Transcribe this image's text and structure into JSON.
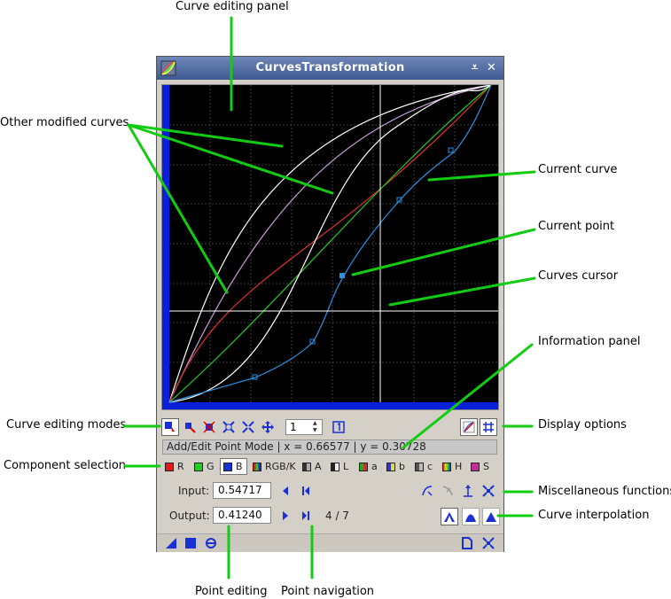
{
  "annotations": {
    "curve_editing_panel": "Curve editing panel",
    "other_modified_curves": "Other modified curves",
    "current_curve": "Current curve",
    "current_point": "Current point",
    "curves_cursor": "Curves cursor",
    "information_panel": "Information panel",
    "curve_editing_modes": "Curve editing modes",
    "display_options": "Display options",
    "component_selection": "Component selection",
    "miscellaneous_functions": "Miscellaneous functions",
    "curve_interpolation": "Curve interpolation",
    "point_editing": "Point editing",
    "point_navigation": "Point navigation"
  },
  "window": {
    "title": "CurvesTransformation",
    "shade_glyph": "⩡",
    "close_glyph": "✕"
  },
  "toolbar": {
    "zoom_value": "1",
    "icons": [
      "add-edit-point-icon",
      "select-point-icon",
      "delete-point-icon",
      "zoom-in-icon",
      "zoom-out-icon",
      "pan-icon",
      "zoom-one-icon",
      "show-all-curves-icon",
      "show-grid-icon"
    ]
  },
  "info_panel": {
    "text": "Add/Edit Point Mode | x = 0.66577 | y = 0.30728"
  },
  "components": [
    {
      "label": "R",
      "color": "#dd1c1c"
    },
    {
      "label": "G",
      "color": "#22cc22"
    },
    {
      "label": "B",
      "color": "#1a2fd6"
    },
    {
      "label": "RGB/K",
      "color": "#999999"
    },
    {
      "label": "A",
      "color": "#888888"
    },
    {
      "label": "L",
      "color": "#aaaaaa"
    },
    {
      "label": "a",
      "color": "#c04040"
    },
    {
      "label": "b",
      "color": "#4040c0"
    },
    {
      "label": "c",
      "color": "#888888"
    },
    {
      "label": "H",
      "color": "#d08020"
    },
    {
      "label": "S",
      "color": "#c03090"
    }
  ],
  "point_editor": {
    "input_label": "Input:",
    "input_value": "0.54717",
    "output_label": "Output:",
    "output_value": "0.41240",
    "point_counter": "4 / 7"
  },
  "colors": {
    "accent": "#1a2fd6",
    "annotation_line": "#11cc11",
    "red_curve": "#e03030",
    "green_curve": "#22cc22",
    "blue_curve": "#2a90e0",
    "purple_curve": "#c8a0d8",
    "white_curve": "#ffffff"
  }
}
